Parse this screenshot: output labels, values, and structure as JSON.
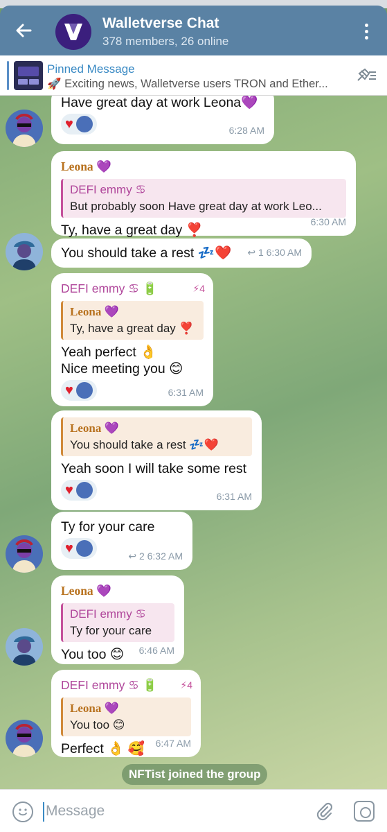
{
  "header": {
    "title": "Walletverse Chat",
    "subtitle": "378 members, 26 online"
  },
  "pinned": {
    "title": "Pinned Message",
    "text": "🚀 Exciting news, Walletverse users  TRON and Ether..."
  },
  "messages": [
    {
      "text": "Have  great day at work Leona💜",
      "time": "6:28 AM"
    },
    {
      "sender": "Leona 💜",
      "reply_name": "DEFI emmy ♋",
      "reply_text": "But probably soon  Have  great day at work Leo...",
      "text": "Ty, have a great day ❣️",
      "time": "6:30 AM"
    },
    {
      "text": "You should take a rest 💤❤️",
      "replies": "↩ 1",
      "time": "6:30 AM"
    },
    {
      "sender": "DEFI emmy ♋ 🔋",
      "badge": "⚡4",
      "reply_name": "Leona 💜",
      "reply_text": "Ty, have a great day ❣️",
      "line1": "Yeah perfect 👌",
      "line2": "Nice meeting you 😊",
      "time": "6:31 AM"
    },
    {
      "reply_name": "Leona 💜",
      "reply_text": "You should take a rest 💤❤️",
      "text": "Yeah soon I will take some rest",
      "time": "6:31 AM"
    },
    {
      "text": "Ty for your care",
      "replies": "↩ 2",
      "time": "6:32 AM"
    },
    {
      "sender": "Leona 💜",
      "reply_name": "DEFI emmy ♋",
      "reply_text": "Ty for your care",
      "text": "You too 😊",
      "time": "6:46 AM"
    },
    {
      "sender": "DEFI emmy ♋ 🔋",
      "badge": "⚡4",
      "reply_name": "Leona 💜",
      "reply_text": "You too 😊",
      "text": "Perfect 👌 🥰",
      "time": "6:47 AM"
    }
  ],
  "service": "NFTist joined the group",
  "composer": {
    "placeholder": "Message"
  }
}
